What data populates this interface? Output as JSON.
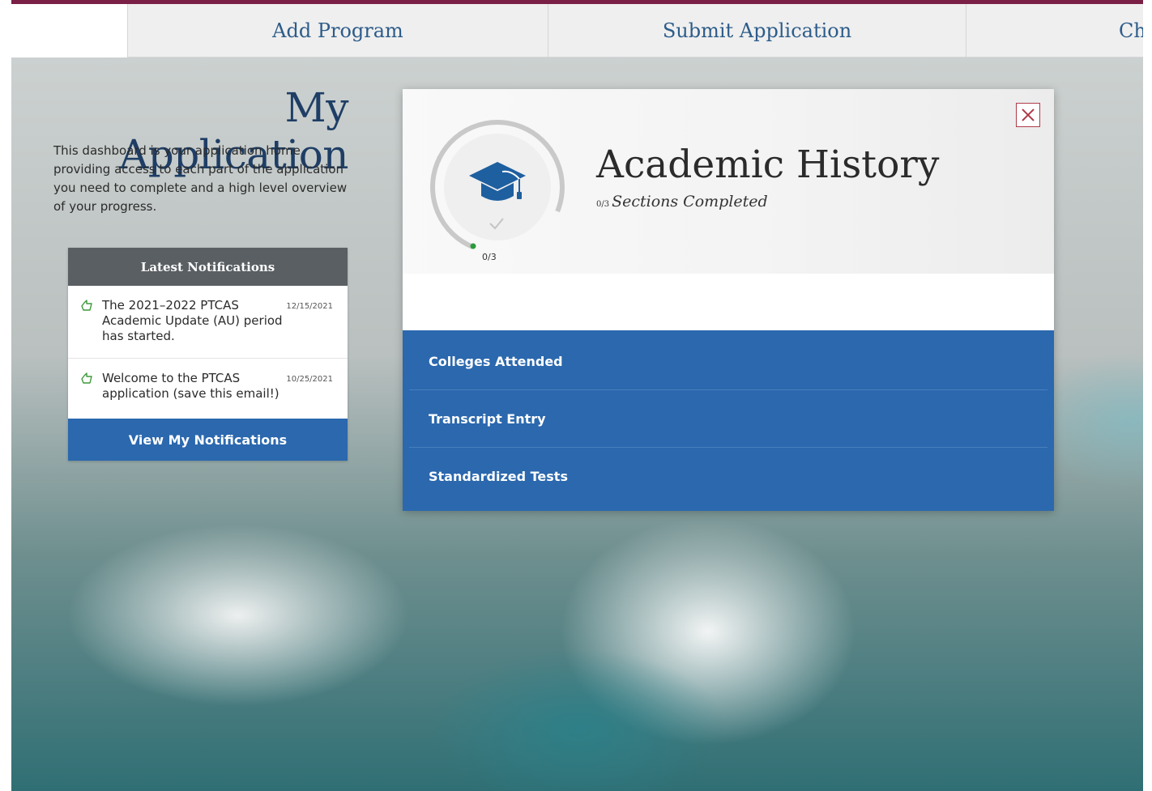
{
  "nav": {
    "tabs": [
      {
        "label": "Add Program"
      },
      {
        "label": "Submit Application"
      },
      {
        "label": "Ch"
      }
    ]
  },
  "dashboard": {
    "title": "My Application",
    "description": "This dashboard is your application home providing access to each part of the application you need to complete and a high level overview of your progress."
  },
  "notifications": {
    "header": "Latest Notifications",
    "items": [
      {
        "text": "The 2021–2022 PTCAS Academic Update (AU) period has started.",
        "date": "12/15/2021",
        "icon": "thumbs-up-icon"
      },
      {
        "text": "Welcome to the PTCAS application (save this email!)",
        "date": "10/25/2021",
        "icon": "thumbs-up-icon"
      }
    ],
    "view_button": "View My Notifications"
  },
  "modal": {
    "title": "Academic History",
    "progress_label": "0/3",
    "progress_fraction": 0,
    "sections_completed_count": "0/3",
    "sections_completed_text": "Sections Completed",
    "icon": "graduation-cap-icon",
    "close_icon": "close-icon",
    "sections": [
      {
        "label": "Colleges Attended"
      },
      {
        "label": "Transcript Entry"
      },
      {
        "label": "Standardized Tests"
      }
    ]
  },
  "colors": {
    "brand_blue": "#2b68ae",
    "title_navy": "#1f3e66",
    "accent_maroon": "#7a1f45",
    "notif_header": "#5a5f63",
    "progress_green": "#2e9a3e"
  }
}
